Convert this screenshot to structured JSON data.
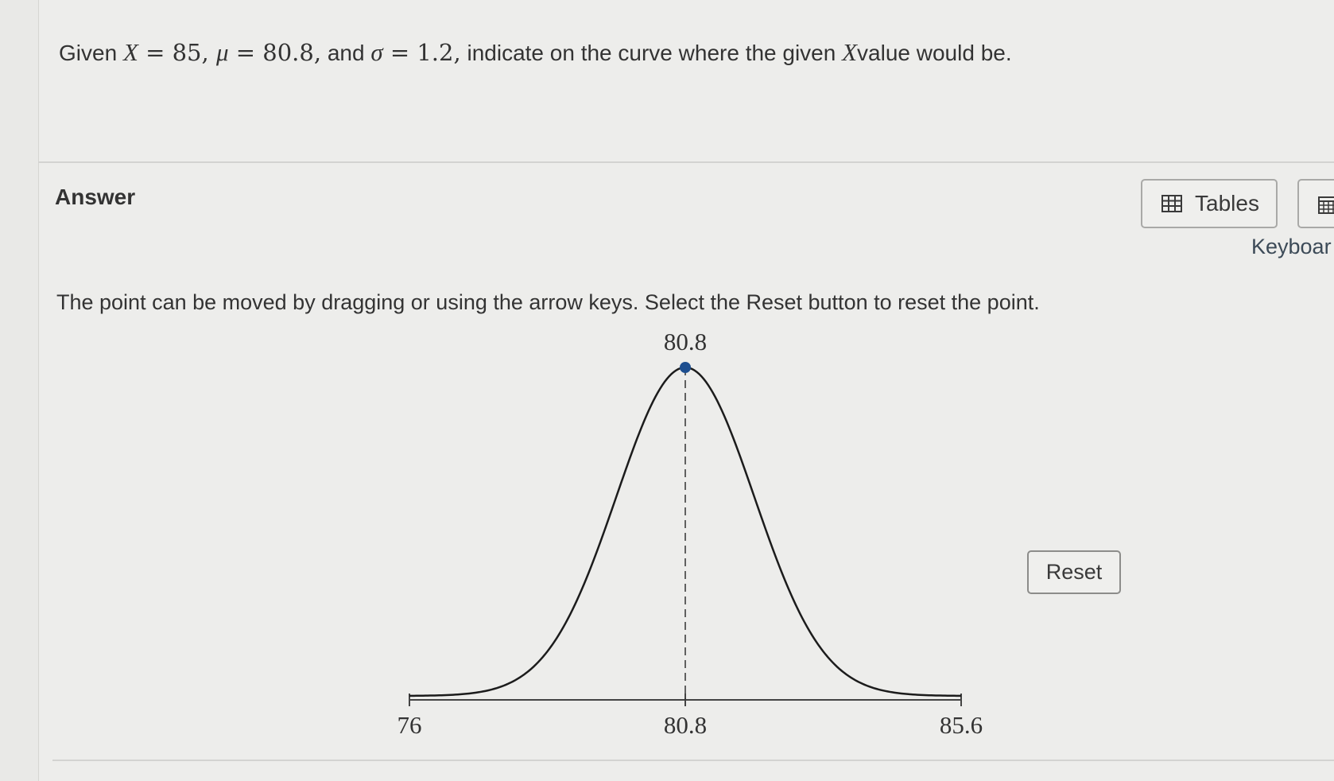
{
  "question": {
    "given": "Given",
    "x_var": "X",
    "eq1": " = 85, ",
    "mu_var": "μ",
    "eq2": " = 80.8,",
    "and": " and ",
    "sigma_var": "σ",
    "eq3": " = 1.2,",
    "tail_a": " indicate on the curve where the given ",
    "x_var2": "X",
    "tail_b": "value would be."
  },
  "answer_heading": "Answer",
  "toolbar": {
    "tables_label": "Tables",
    "keyboard_label": "Keyboar"
  },
  "instruction": "The point can be moved by dragging or using the arrow keys. Select the Reset button to reset the point.",
  "reset_label": "Reset",
  "chart_data": {
    "type": "line",
    "distribution": "normal",
    "mean": 80.8,
    "sd": 1.2,
    "xlim": [
      76,
      85.6
    ],
    "ticks": [
      {
        "value": 76,
        "label": "76"
      },
      {
        "value": 80.8,
        "label": "80.8"
      },
      {
        "value": 85.6,
        "label": "85.6"
      }
    ],
    "point": {
      "x": 80.8,
      "label": "80.8"
    },
    "colors": {
      "curve": "#1c1c1c",
      "point": "#1d4e8f"
    }
  }
}
